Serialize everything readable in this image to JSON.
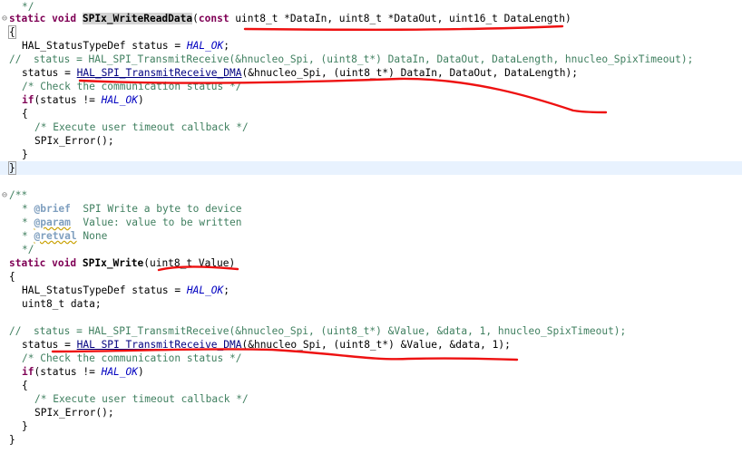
{
  "editor": {
    "lines": {
      "l1_comment_end": "*/",
      "l2_static": "static",
      "l2_void": "void",
      "l2_fn": "SPIx_WriteReadData",
      "l2_open": "(",
      "l2_const": "const",
      "l2_params": " uint8_t *DataIn, uint8_t *DataOut, uint16_t DataLength)",
      "l3_brace": "{",
      "l4_type": "HAL_StatusTypeDef status = ",
      "l4_macro": "HAL_OK",
      "l4_end": ";",
      "l5_comment": "//  status = HAL_SPI_TransmitReceive(&hnucleo_Spi, (uint8_t*) DataIn, DataOut, DataLength, hnucleo_SpixTimeout);",
      "l6_lhs": "status = ",
      "l6_fn": "HAL_SPI_TransmitReceive_DMA",
      "l6_args": "(&hnucleo_Spi, (uint8_t*) DataIn, DataOut, DataLength);",
      "l7_comment": "/* Check the communication status */",
      "l8_if": "if",
      "l8_mid": "(status != ",
      "l8_macro": "HAL_OK",
      "l8_end": ")",
      "l9_brace": "{",
      "l10_comment": "/* Execute user timeout callback */",
      "l11_call": "SPIx_Error();",
      "l12_brace": "}",
      "l13_brace": "}",
      "l15_doc_open": "/**",
      "l16_tag": "@brief",
      "l16_text": "  SPI Write a byte to device",
      "l17_tag": "@param",
      "l17_text": "  Value: value to be written",
      "l18_tag": "@retval",
      "l18_text": " None",
      "l19_doc_close": "*/",
      "l20_static": "static",
      "l20_void": "void",
      "l20_fn": "SPIx_Write",
      "l20_params": "(uint8_t Value)",
      "l21_brace": "{",
      "l22_type": "HAL_StatusTypeDef status = ",
      "l22_macro": "HAL_OK",
      "l22_end": ";",
      "l23_decl": "uint8_t data;",
      "l25_comment": "//  status = HAL_SPI_TransmitReceive(&hnucleo_Spi, (uint8_t*) &Value, &data, 1, hnucleo_SpixTimeout);",
      "l26_lhs": "status = ",
      "l26_fn": "HAL_SPI_TransmitReceive_DMA",
      "l26_args": "(&hnucleo_Spi, (uint8_t*) &Value, &data, 1);",
      "l27_comment": "/* Check the communication status */",
      "l28_if": "if",
      "l28_mid": "(status != ",
      "l28_macro": "HAL_OK",
      "l28_end": ")",
      "l29_brace": "{",
      "l30_comment": "/* Execute user timeout callback */",
      "l31_call": "SPIx_Error();",
      "l32_brace": "}",
      "l33_brace": "}"
    },
    "gutter": {
      "fold_2": "⊖",
      "fold_15": "⊖"
    },
    "colors": {
      "background": "#ffffff",
      "keyword": "#7f0055",
      "comment": "#3f7f5f",
      "javadoc_tag": "#7f9fbf",
      "macro": "#0000c0",
      "current_line": "#e8f2fe",
      "annotation": "#ee1111"
    }
  }
}
